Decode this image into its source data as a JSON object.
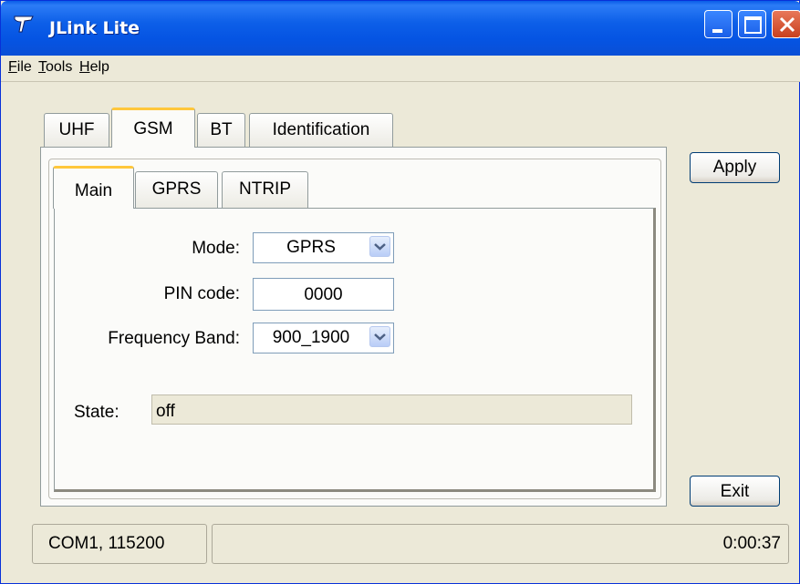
{
  "window": {
    "title": "JLink Lite"
  },
  "menu": [
    "File",
    "Tools",
    "Help"
  ],
  "outer_tabs": [
    "UHF",
    "GSM",
    "BT",
    "Identification"
  ],
  "outer_active_tab": "GSM",
  "inner_tabs": [
    "Main",
    "GPRS",
    "NTRIP"
  ],
  "inner_active_tab": "Main",
  "form": {
    "mode_label": "Mode:",
    "mode_value": "GPRS",
    "pin_label": "PIN code:",
    "pin_value": "0000",
    "band_label": "Frequency Band:",
    "band_value": "900_1900",
    "state_label": "State:",
    "state_value": "off"
  },
  "buttons": {
    "apply": "Apply",
    "exit": "Exit"
  },
  "status": {
    "port": "COM1, 115200",
    "middle": "",
    "timer": "0:00:37"
  },
  "colors": {
    "titlebar": "#0554e3",
    "active_tab_accent": "#ffc73c",
    "close_button": "#d8532e"
  }
}
